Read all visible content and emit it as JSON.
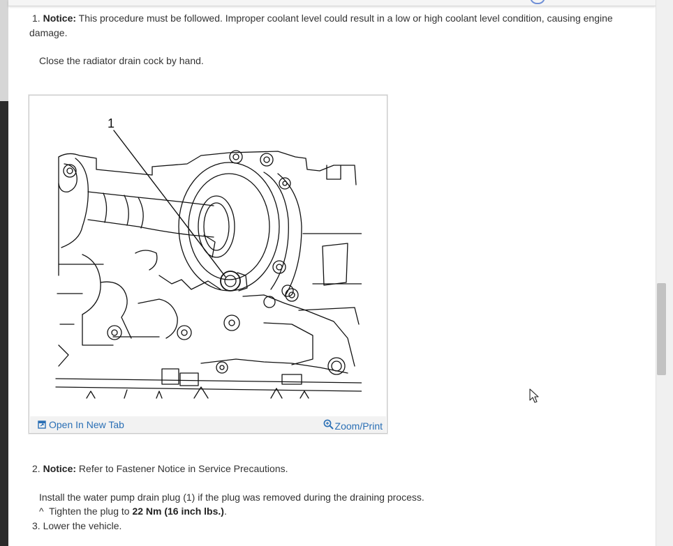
{
  "steps": [
    {
      "number": "1.",
      "notice_label": "Notice:",
      "notice_text": "This procedure must be followed. Improper coolant level could result in a low or high coolant level condition, causing engine",
      "notice_text_cont": "damage.",
      "instruction": "Close the radiator drain cock by hand."
    },
    {
      "number": "2.",
      "notice_label": "Notice:",
      "notice_text": "Refer to Fastener Notice in Service Precautions.",
      "instruction": "Install the water pump drain plug (1) if the plug was removed during the draining process.",
      "spec_marker": "^",
      "spec_prefix": "Tighten the plug to",
      "spec_value": "22 Nm (16 inch lbs.)",
      "spec_suffix": "."
    },
    {
      "number": "3.",
      "text": "Lower the vehicle."
    }
  ],
  "figure": {
    "callout": "1",
    "open_tab_icon": "open-new-tab-icon",
    "open_tab_label": "Open In New Tab",
    "zoom_icon": "zoom-magnifier-icon",
    "zoom_label": "Zoom/Print"
  },
  "colors": {
    "link": "#2a6fb5",
    "body_text": "#333333",
    "caption_bar": "#f2f2f2"
  }
}
